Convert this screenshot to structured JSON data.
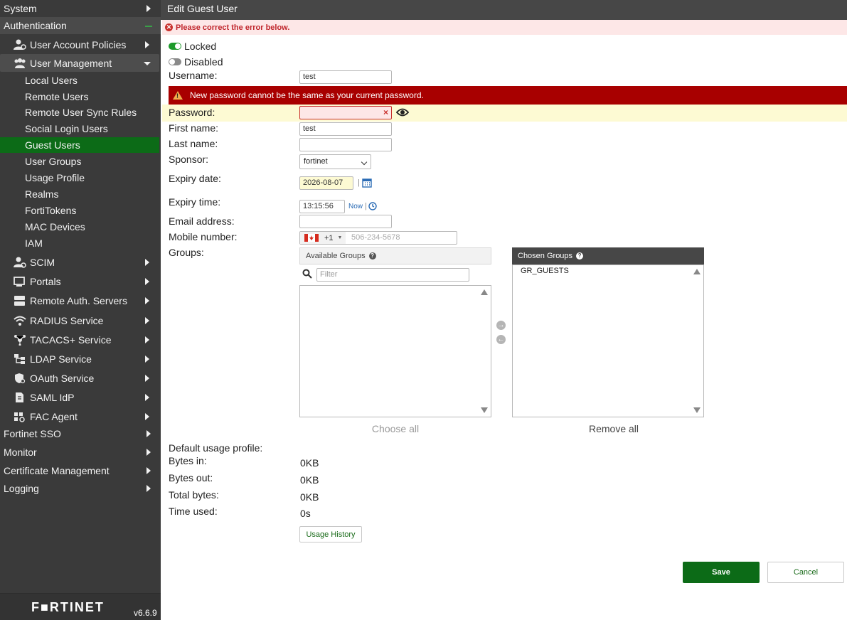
{
  "sidebar": {
    "system": "System",
    "authentication": "Authentication",
    "user_account_policies": "User Account Policies",
    "user_management": "User Management",
    "leaves": [
      "Local Users",
      "Remote Users",
      "Remote User Sync Rules",
      "Social Login Users",
      "Guest Users",
      "User Groups",
      "Usage Profile",
      "Realms",
      "FortiTokens",
      "MAC Devices",
      "IAM"
    ],
    "scim": "SCIM",
    "portals": "Portals",
    "remote_auth_servers": "Remote Auth. Servers",
    "radius_service": "RADIUS Service",
    "tacacs_service": "TACACS+ Service",
    "ldap_service": "LDAP Service",
    "oauth_service": "OAuth Service",
    "saml_idp": "SAML IdP",
    "fac_agent": "FAC Agent",
    "fortinet_sso": "Fortinet SSO",
    "monitor": "Monitor",
    "certificate_management": "Certificate Management",
    "logging": "Logging",
    "brand": "F■RTINET",
    "version": "v6.6.9"
  },
  "page": {
    "title": "Edit Guest User",
    "error_banner": "Please correct the error below."
  },
  "form": {
    "locked_label": "Locked",
    "disabled_label": "Disabled",
    "username_label": "Username:",
    "username_value": "test",
    "password_error": "New password cannot be the same as your current password.",
    "password_label": "Password:",
    "first_name_label": "First name:",
    "first_name_value": "test",
    "last_name_label": "Last name:",
    "sponsor_label": "Sponsor:",
    "sponsor_value": "fortinet",
    "expiry_date_label": "Expiry date:",
    "expiry_date_value": "2026-08-07",
    "expiry_time_label": "Expiry time:",
    "expiry_time_value": "13:15:56",
    "now_link": "Now",
    "email_label": "Email address:",
    "mobile_label": "Mobile number:",
    "country_code": "+1",
    "mobile_placeholder": "506-234-5678",
    "groups_label": "Groups:",
    "available_groups": "Available Groups",
    "filter_placeholder": "Filter",
    "chosen_groups": "Chosen Groups",
    "chosen_items": [
      "GR_GUESTS"
    ],
    "choose_all": "Choose all",
    "remove_all": "Remove all",
    "default_usage_profile_label": "Default usage profile:",
    "bytes_in_label": "Bytes in:",
    "bytes_in_value": "0KB",
    "bytes_out_label": "Bytes out:",
    "bytes_out_value": "0KB",
    "total_bytes_label": "Total bytes:",
    "total_bytes_value": "0KB",
    "time_used_label": "Time used:",
    "time_used_value": "0s",
    "usage_history_button": "Usage History"
  },
  "footer": {
    "save": "Save",
    "cancel": "Cancel"
  },
  "colors": {
    "sidebar_bg": "#3a3a3a",
    "active_green": "#0c6b17",
    "error_red": "#a80000",
    "error_banner_bg": "#fde7e7",
    "highlight_yellow": "#fdfad3"
  }
}
